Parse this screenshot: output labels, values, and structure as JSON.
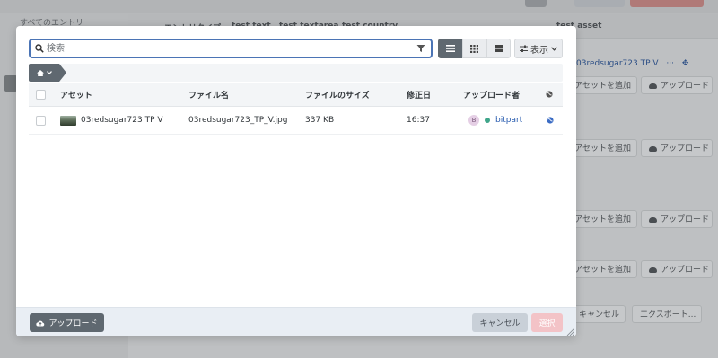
{
  "background": {
    "sidebar_title": "すべてのエントリ",
    "header_columns": [
      "エントリタイプ",
      "test text",
      "test textarea",
      "test country"
    ],
    "header_asset_column": "test asset",
    "asset_link": "03redsugar723 TP V",
    "add_asset_label": "アセットを追加",
    "upload_label": "アップロード",
    "cancel_label": "キャンセル",
    "export_label": "エクスポート..."
  },
  "modal": {
    "search": {
      "placeholder": "検索",
      "value": ""
    },
    "view_modes": [
      "list-icon",
      "grid-icon",
      "table-icon"
    ],
    "display_label": "表示",
    "table": {
      "headers": {
        "asset": "アセット",
        "filename": "ファイル名",
        "size": "ファイルのサイズ",
        "modified": "修正日",
        "uploader": "アップロード者"
      },
      "rows": [
        {
          "asset": "03redsugar723 TP V",
          "filename": "03redsugar723_TP_V.jpg",
          "size": "337 KB",
          "modified": "16:37",
          "avatar_initial": "B",
          "uploader": "bitpart"
        }
      ]
    },
    "footer": {
      "upload_label": "アップロード",
      "cancel_label": "キャンセル",
      "select_label": "選択"
    }
  },
  "colors": {
    "accent": "#4b74b5",
    "dark_button": "#5f6870",
    "status_dot": "#3fa58a",
    "link": "#2a5db0",
    "disabled_select": "#f3c3c7"
  }
}
